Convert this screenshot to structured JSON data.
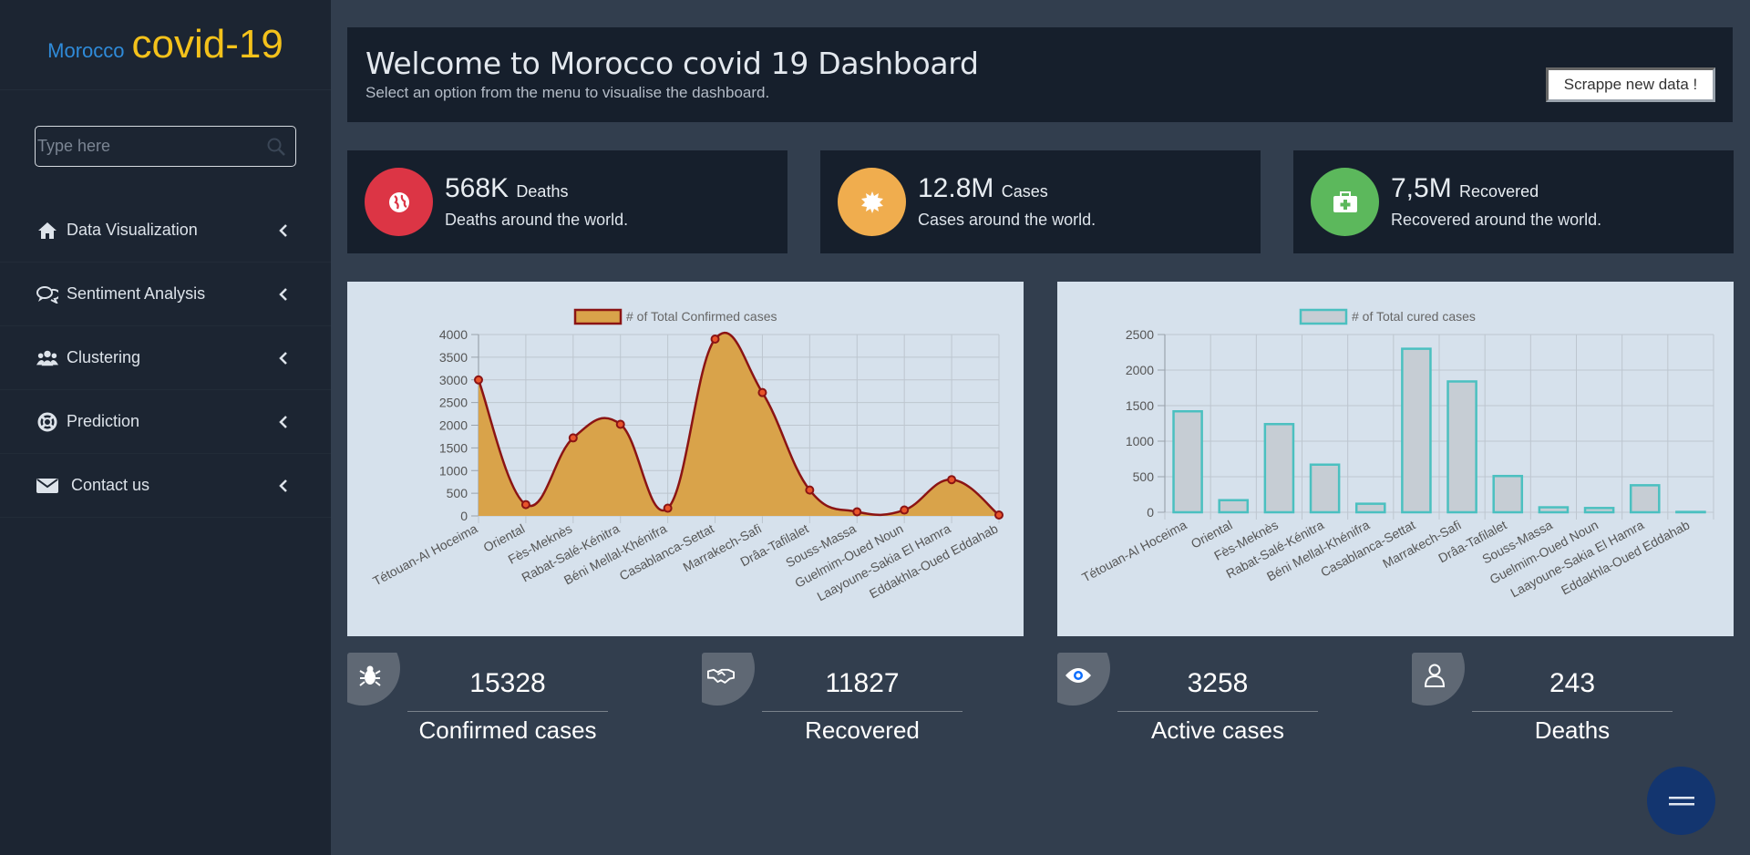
{
  "brand": {
    "small": "Morocco",
    "big": "covid-19"
  },
  "search": {
    "placeholder": "Type here"
  },
  "nav": {
    "items": [
      {
        "label": "Data Visualization",
        "icon": "home-icon"
      },
      {
        "label": "Sentiment Analysis",
        "icon": "chat-icon"
      },
      {
        "label": "Clustering",
        "icon": "users-icon"
      },
      {
        "label": "Prediction",
        "icon": "lifebuoy-icon"
      },
      {
        "label": "Contact us",
        "icon": "envelope-icon"
      }
    ]
  },
  "header": {
    "title": "Welcome to Morocco covid 19 Dashboard",
    "subtitle": "Select an option from the menu to visualise the dashboard.",
    "button": "Scrappe new data !"
  },
  "stats": [
    {
      "value": "568K",
      "unit": "Deaths",
      "desc": "Deaths around the world.",
      "color": "#dc3545",
      "icon": "globe-icon"
    },
    {
      "value": "12.8M",
      "unit": "Cases",
      "desc": "Cases around the world.",
      "color": "#f0ad4e",
      "icon": "virus-icon"
    },
    {
      "value": "7,5M",
      "unit": "Recovered",
      "desc": "Recovered around the world.",
      "color": "#5cb85c",
      "icon": "medkit-icon"
    }
  ],
  "cards": [
    {
      "number": "15328",
      "label": "Confirmed cases",
      "color": "#f0ad4e",
      "icon": "bug-icon"
    },
    {
      "number": "11827",
      "label": "Recovered",
      "color": "#5cb85c",
      "icon": "handshake-icon"
    },
    {
      "number": "3258",
      "label": "Active cases",
      "color": "#0d6efd",
      "icon": "eye-icon"
    },
    {
      "number": "243",
      "label": "Deaths",
      "color": "#d9534f",
      "icon": "user-icon"
    }
  ],
  "chart_data": [
    {
      "type": "area",
      "legend": "# of Total Confirmed cases",
      "categories": [
        "Tétouan-Al Hoceima",
        "Oriental",
        "Fès-Meknès",
        "Rabat-Salé-Kénitra",
        "Béni Mellal-Khénifra",
        "Casablanca-Settat",
        "Marrakech-Safi",
        "Drâa-Tafilalet",
        "Souss-Massa",
        "Guelmim-Oued Noun",
        "Laayoune-Sakia El Hamra",
        "Eddakhla-Oued Eddahab"
      ],
      "values": [
        3000,
        250,
        1720,
        2020,
        170,
        3900,
        2720,
        570,
        90,
        130,
        800,
        20
      ],
      "ylim": [
        0,
        4000
      ],
      "yticks": [
        0,
        500,
        1000,
        1500,
        2000,
        2500,
        3000,
        3500,
        4000
      ],
      "fill": "#d9a34a",
      "stroke": "#8b1414",
      "grid": true,
      "legend_position": "top"
    },
    {
      "type": "bar",
      "legend": "# of Total cured cases",
      "categories": [
        "Tétouan-Al Hoceima",
        "Oriental",
        "Fès-Meknès",
        "Rabat-Salé-Kénitra",
        "Béni Mellal-Khénifra",
        "Casablanca-Settat",
        "Marrakech-Safi",
        "Drâa-Tafilalet",
        "Souss-Massa",
        "Guelmim-Oued Noun",
        "Laayoune-Sakia El Hamra",
        "Eddakhla-Oued Eddahab"
      ],
      "values": [
        1420,
        170,
        1240,
        670,
        120,
        2300,
        1840,
        510,
        70,
        60,
        380,
        5
      ],
      "ylim": [
        0,
        2500
      ],
      "yticks": [
        0,
        500,
        1000,
        1500,
        2000,
        2500
      ],
      "fill": "#c6cdd4",
      "stroke": "#4bc0c0",
      "grid": true,
      "legend_position": "top"
    }
  ]
}
